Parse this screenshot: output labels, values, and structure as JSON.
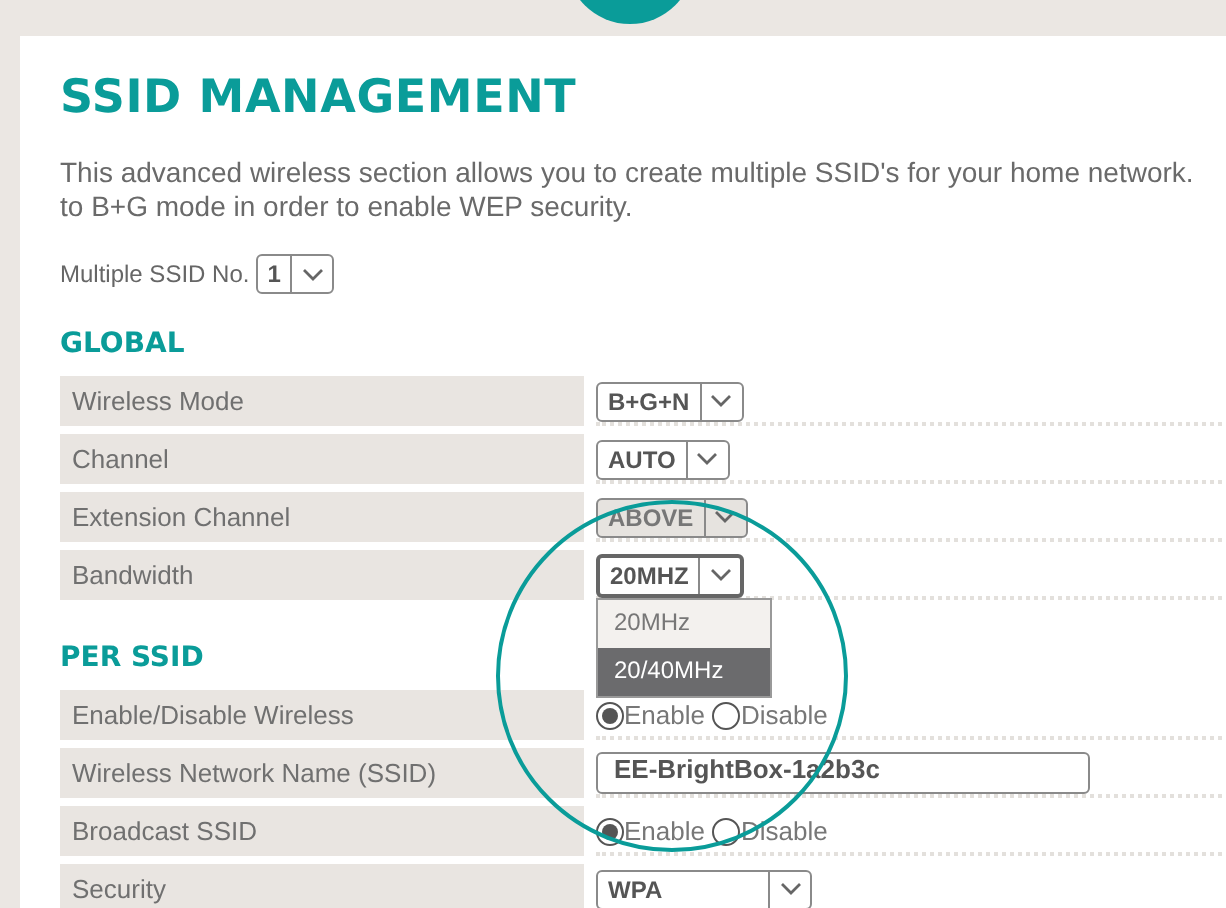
{
  "title": "SSID MANAGEMENT",
  "description_lines": [
    "This advanced wireless section allows you to create multiple SSID's for your home network.",
    "to B+G mode in order to enable WEP security."
  ],
  "multiple_ssid": {
    "label": "Multiple SSID No.",
    "value": "1"
  },
  "sections": [
    {
      "heading": "GLOBAL",
      "rows": [
        {
          "kind": "select",
          "label": "Wireless Mode",
          "value": "B+G+N",
          "disabled": false,
          "open": false
        },
        {
          "kind": "select",
          "label": "Channel",
          "value": "AUTO",
          "disabled": false,
          "open": false
        },
        {
          "kind": "select",
          "label": "Extension Channel",
          "value": "ABOVE",
          "disabled": true,
          "open": false
        },
        {
          "kind": "select",
          "label": "Bandwidth",
          "value": "20MHZ",
          "disabled": false,
          "open": true,
          "options": [
            {
              "label": "20MHz",
              "selected": false
            },
            {
              "label": "20/40MHz",
              "selected": true
            }
          ]
        }
      ]
    },
    {
      "heading": "PER SSID",
      "rows": [
        {
          "kind": "radio",
          "label": "Enable/Disable Wireless",
          "choices": [
            {
              "label": "Enable",
              "selected": true
            },
            {
              "label": "Disable",
              "selected": false
            }
          ]
        },
        {
          "kind": "text",
          "label": "Wireless Network Name (SSID)",
          "value": "EE-BrightBox-1a2b3c"
        },
        {
          "kind": "radio",
          "label": "Broadcast SSID",
          "choices": [
            {
              "label": "Enable",
              "selected": true
            },
            {
              "label": "Disable",
              "selected": false
            }
          ]
        },
        {
          "kind": "select",
          "label": "Security",
          "value": "WPA",
          "disabled": false,
          "open": false
        }
      ]
    }
  ]
}
